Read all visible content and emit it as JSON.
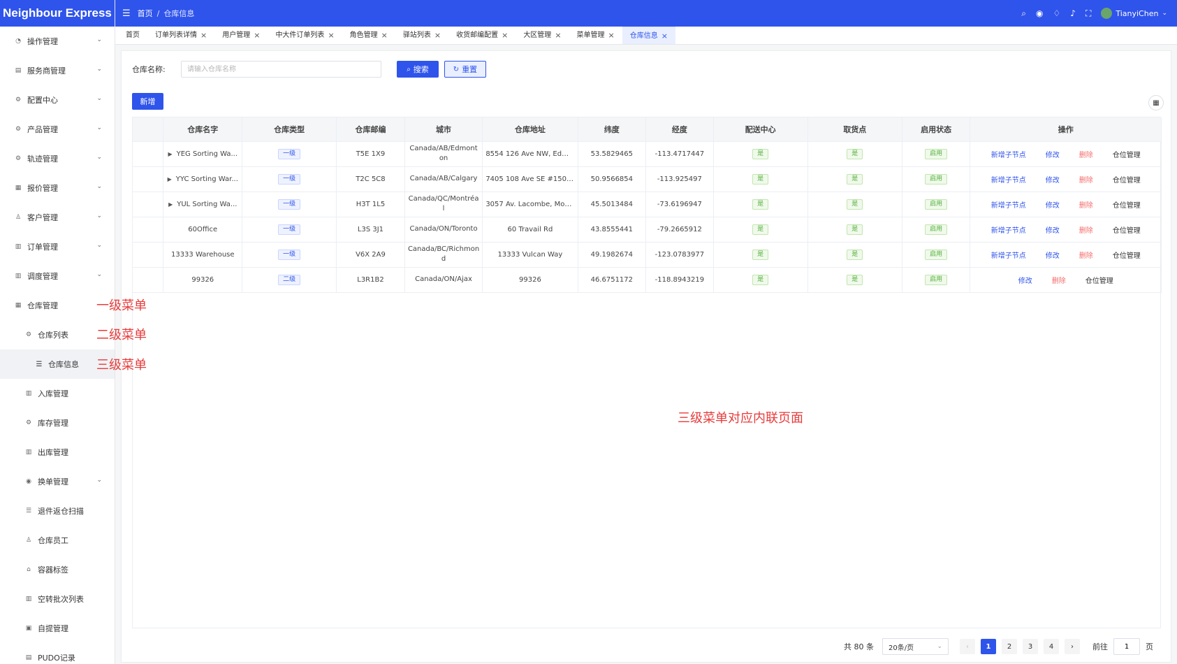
{
  "app": {
    "logo": "Neighbour Express"
  },
  "header": {
    "breadcrumb": [
      "首页",
      "仓库信息"
    ],
    "username": "TianyiChen"
  },
  "sidebar": {
    "items": [
      {
        "label": "操作管理",
        "level": 1,
        "icon": "dashboard-icon",
        "arrow": true
      },
      {
        "label": "服务商管理",
        "level": 1,
        "icon": "doc-icon",
        "arrow": true
      },
      {
        "label": "配置中心",
        "level": 1,
        "icon": "gear-icon",
        "arrow": true
      },
      {
        "label": "产品管理",
        "level": 1,
        "icon": "gear-icon",
        "arrow": true
      },
      {
        "label": "轨迹管理",
        "level": 1,
        "icon": "gear-icon",
        "arrow": true
      },
      {
        "label": "报价管理",
        "level": 1,
        "icon": "calendar-icon",
        "arrow": true
      },
      {
        "label": "客户管理",
        "level": 1,
        "icon": "user-icon",
        "arrow": true
      },
      {
        "label": "订单管理",
        "level": 1,
        "icon": "book-icon",
        "arrow": true
      },
      {
        "label": "调度管理",
        "level": 1,
        "icon": "book-icon",
        "arrow": true
      },
      {
        "label": "仓库管理",
        "level": 1,
        "icon": "table-icon",
        "arrow": false
      },
      {
        "label": "仓库列表",
        "level": 2,
        "icon": "gear-icon",
        "arrow": false
      },
      {
        "label": "仓库信息",
        "level": 3,
        "icon": "list-icon",
        "arrow": false,
        "active": true
      },
      {
        "label": "入库管理",
        "level": 2,
        "icon": "book-icon",
        "arrow": false
      },
      {
        "label": "库存管理",
        "level": 2,
        "icon": "gear-icon",
        "arrow": false
      },
      {
        "label": "出库管理",
        "level": 2,
        "icon": "book-icon",
        "arrow": false
      },
      {
        "label": "换单管理",
        "level": 2,
        "icon": "eye-icon",
        "arrow": true
      },
      {
        "label": "退件返仓扫描",
        "level": 2,
        "icon": "list-icon",
        "arrow": false
      },
      {
        "label": "仓库员工",
        "level": 2,
        "icon": "user-icon",
        "arrow": false
      },
      {
        "label": "容器标签",
        "level": 2,
        "icon": "tag-icon",
        "arrow": false
      },
      {
        "label": "空转批次列表",
        "level": 2,
        "icon": "book-icon",
        "arrow": false
      },
      {
        "label": "自提管理",
        "level": 2,
        "icon": "clipboard-icon",
        "arrow": false
      },
      {
        "label": "PUDO记录",
        "level": 2,
        "icon": "doc-icon",
        "arrow": false
      }
    ]
  },
  "tabs": [
    {
      "label": "首页",
      "closable": false
    },
    {
      "label": "订单列表详情",
      "closable": true
    },
    {
      "label": "用户管理",
      "closable": true
    },
    {
      "label": "中大件订单列表",
      "closable": true
    },
    {
      "label": "角色管理",
      "closable": true
    },
    {
      "label": "驿站列表",
      "closable": true
    },
    {
      "label": "收货邮编配置",
      "closable": true
    },
    {
      "label": "大区管理",
      "closable": true
    },
    {
      "label": "菜单管理",
      "closable": true
    },
    {
      "label": "仓库信息",
      "closable": true,
      "active": true
    }
  ],
  "search": {
    "label": "仓库名称:",
    "placeholder": "请输入仓库名称",
    "search_button": "搜索",
    "reset_button": "重置",
    "add_button": "新增"
  },
  "table": {
    "columns": [
      "仓库名字",
      "仓库类型",
      "仓库邮编",
      "城市",
      "仓库地址",
      "纬度",
      "经度",
      "配送中心",
      "取货点",
      "启用状态",
      "操作"
    ],
    "rows": [
      {
        "name": "YEG Sorting Wa...",
        "expandable": true,
        "type": "一级",
        "postal": "T5E 1X9",
        "city": "Canada/AB/Edmonton",
        "address": "8554 126 Ave NW, Edm...",
        "lat": "53.5829465",
        "lng": "-113.4717447",
        "delivery": "是",
        "pickup": "是",
        "status": "启用",
        "ops": [
          "新增子节点",
          "修改",
          "删除",
          "仓位管理"
        ]
      },
      {
        "name": "YYC Sorting War...",
        "expandable": true,
        "type": "一级",
        "postal": "T2C 5C8",
        "city": "Canada/AB/Calgary",
        "address": "7405 108 Ave SE #150, ...",
        "lat": "50.9566854",
        "lng": "-113.925497",
        "delivery": "是",
        "pickup": "是",
        "status": "启用",
        "ops": [
          "新增子节点",
          "修改",
          "删除",
          "仓位管理"
        ]
      },
      {
        "name": "YUL Sorting Wa...",
        "expandable": true,
        "type": "一级",
        "postal": "H3T 1L5",
        "city": "Canada/QC/Montréal",
        "address": "3057 Av. Lacombe, Mon...",
        "lat": "45.5013484",
        "lng": "-73.6196947",
        "delivery": "是",
        "pickup": "是",
        "status": "启用",
        "ops": [
          "新增子节点",
          "修改",
          "删除",
          "仓位管理"
        ]
      },
      {
        "name": "60Office",
        "expandable": false,
        "type": "一级",
        "postal": "L3S 3J1",
        "city": "Canada/ON/Toronto",
        "address": "60 Travail Rd",
        "lat": "43.8555441",
        "lng": "-79.2665912",
        "delivery": "是",
        "pickup": "是",
        "status": "启用",
        "ops": [
          "新增子节点",
          "修改",
          "删除",
          "仓位管理"
        ]
      },
      {
        "name": "13333 Warehouse",
        "expandable": false,
        "type": "一级",
        "postal": "V6X 2A9",
        "city": "Canada/BC/Richmond",
        "address": "13333 Vulcan Way",
        "lat": "49.1982674",
        "lng": "-123.0783977",
        "delivery": "是",
        "pickup": "是",
        "status": "启用",
        "ops": [
          "新增子节点",
          "修改",
          "删除",
          "仓位管理"
        ]
      },
      {
        "name": "99326",
        "expandable": false,
        "type": "二级",
        "postal": "L3R1B2",
        "city": "Canada/ON/Ajax",
        "address": "99326",
        "lat": "46.6751172",
        "lng": "-118.8943219",
        "delivery": "是",
        "pickup": "是",
        "status": "启用",
        "ops": [
          "修改",
          "删除",
          "仓位管理"
        ]
      }
    ]
  },
  "pagination": {
    "total": "共 80 条",
    "page_size": "20条/页",
    "pages": [
      "1",
      "2",
      "3",
      "4"
    ],
    "current": "1",
    "goto_label": "前往",
    "goto_value": "1",
    "page_unit": "页"
  },
  "annotations": {
    "level1": "一级菜单",
    "level2": "二级菜单",
    "level3": "三级菜单",
    "inline_page": "三级菜单对应内联页面"
  },
  "colors": {
    "primary": "#2f54eb",
    "danger": "#f56c6c",
    "success": "#52b03a",
    "annotation": "#e83b3b"
  }
}
